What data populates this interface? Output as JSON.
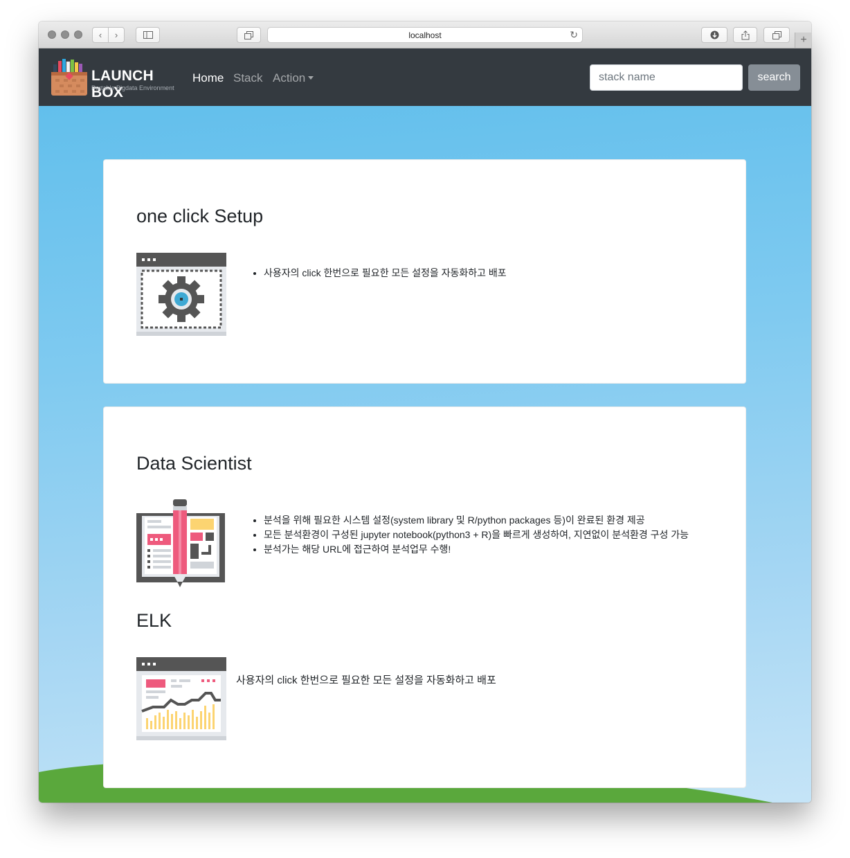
{
  "browser": {
    "url": "localhost"
  },
  "navbar": {
    "brand_title": "LAUNCH BOX",
    "brand_subtitle": "Portable Bigdata Environment",
    "links": [
      {
        "label": "Home",
        "active": true
      },
      {
        "label": "Stack",
        "active": false
      },
      {
        "label": "Action",
        "active": false,
        "dropdown": true
      }
    ],
    "search": {
      "placeholder": "stack name",
      "value": "",
      "button_label": "search"
    }
  },
  "sections": {
    "setup": {
      "title": "one click Setup",
      "icon": "gear-window-icon",
      "bullets": [
        "사용자의 click 한번으로 필요한 모든 설정을 자동화하고 배포"
      ]
    },
    "data_scientist": {
      "title": "Data Scientist",
      "icon": "pencil-notebook-icon",
      "bullets": [
        "분석을 위해 필요한 시스템 설정(system library 및 R/python packages 등)이 완료된 환경 제공",
        "모든 분석환경이 구성된 jupyter notebook(python3 + R)을 빠르게 생성하여, 지연없이 분석환경 구성 가능",
        "분석가는 해당 URL에 접근하여 분석업무 수행!"
      ]
    },
    "elk": {
      "title": "ELK",
      "icon": "dashboard-chart-icon",
      "text": "사용자의 click 한번으로 필요한 모든 설정을 자동화하고 배포"
    }
  },
  "colors": {
    "navbar_bg": "#343a40",
    "sky": "#62bfec",
    "grass": "#5aa83c",
    "search_button": "#868e96"
  }
}
